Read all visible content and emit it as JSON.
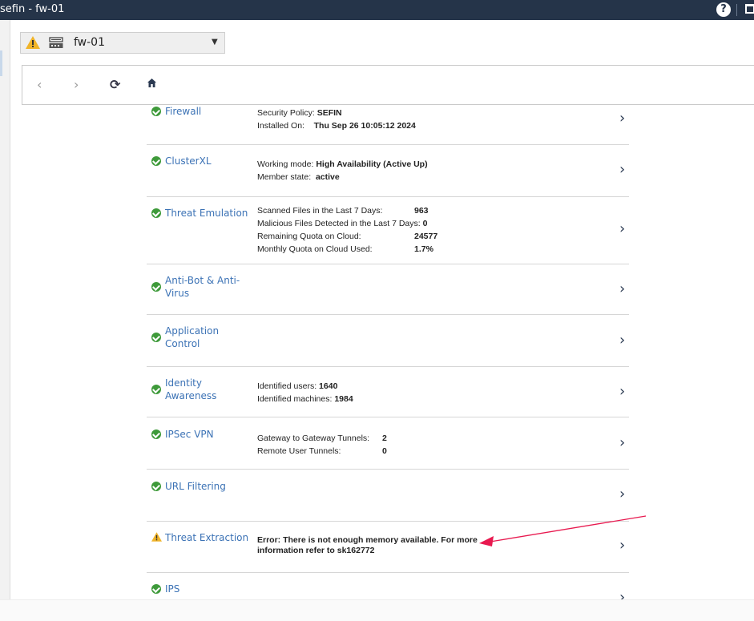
{
  "window": {
    "title": "sefin - fw-01"
  },
  "gateway_selector": {
    "name": "fw-01"
  },
  "blades": [
    {
      "name": "Firewall",
      "status": "ok",
      "lines": [
        {
          "label": "Security Policy: ",
          "value": "SEFIN"
        },
        {
          "label": "Installed On:    ",
          "value": "Thu Sep 26 10:05:12 2024"
        }
      ]
    },
    {
      "name": "ClusterXL",
      "status": "ok",
      "lines": [
        {
          "label": "Working mode: ",
          "value": "High Availability (Active Up)"
        },
        {
          "label": "Member state:  ",
          "value": "active"
        }
      ]
    },
    {
      "name": "Threat Emulation",
      "status": "ok",
      "lines": [
        {
          "label": "Scanned Files in the Last 7 Days:",
          "value": "963"
        },
        {
          "label": "Malicious Files Detected in the Last 7 Days:",
          "value": "0"
        },
        {
          "label": "Remaining Quota on Cloud:",
          "value": "24577"
        },
        {
          "label": "Monthly Quota on Cloud Used:",
          "value": "1.7%"
        }
      ]
    },
    {
      "name_l1": "Anti-Bot & Anti-",
      "name_l2": "Virus",
      "status": "ok"
    },
    {
      "name_l1": "Application",
      "name_l2": "Control",
      "status": "ok"
    },
    {
      "name_l1": "Identity",
      "name_l2": "Awareness",
      "status": "ok",
      "lines": [
        {
          "label": "Identified users: ",
          "value": "1640"
        },
        {
          "label": "Identified machines: ",
          "value": "1984"
        }
      ]
    },
    {
      "name": "IPSec VPN",
      "status": "ok",
      "lines": [
        {
          "label": "Gateway to Gateway Tunnels:",
          "value": "2"
        },
        {
          "label": "Remote User Tunnels:",
          "value": "0"
        }
      ]
    },
    {
      "name": "URL Filtering",
      "status": "ok"
    },
    {
      "name": "Threat Extraction",
      "status": "warning",
      "error_l1": "Error: There is not enough memory available. For more",
      "error_l2": "information refer to sk162772"
    },
    {
      "name": "IPS",
      "status": "ok"
    }
  ],
  "colors": {
    "titlebar": "#253449",
    "blade_link": "#3b72b5",
    "ok_green": "#3e9a3a",
    "warning_yellow": "#f0b429",
    "annotation_arrow": "#e8194f"
  },
  "icons": {
    "help": "?",
    "back": "‹",
    "forward": "›",
    "refresh": "⟳",
    "chevron": "›",
    "caret": "▼"
  }
}
